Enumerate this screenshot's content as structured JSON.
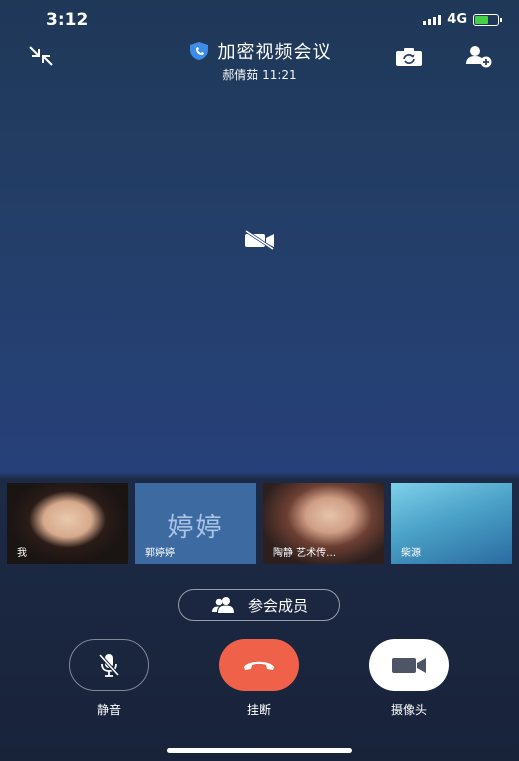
{
  "status_bar": {
    "time": "3:12",
    "network": "4G"
  },
  "header": {
    "title": "加密视频会议",
    "subtitle": "郝倩茹 11:21"
  },
  "icons": {
    "minimize": "collapse-arrows-icon",
    "switch_camera": "switch-camera-icon",
    "add_member": "add-user-icon",
    "camera_off": "video-off-icon"
  },
  "participants": [
    {
      "name": "我"
    },
    {
      "name": "郭婷婷",
      "avatar_text": "婷婷"
    },
    {
      "name": "陶静 艺术传…"
    },
    {
      "name": "柴源"
    }
  ],
  "members_button": {
    "label": "参会成员"
  },
  "controls": {
    "mute": {
      "label": "静音"
    },
    "hangup": {
      "label": "挂断"
    },
    "camera": {
      "label": "摄像头"
    }
  },
  "colors": {
    "hangup": "#f06149",
    "accent": "#2f7de1"
  }
}
